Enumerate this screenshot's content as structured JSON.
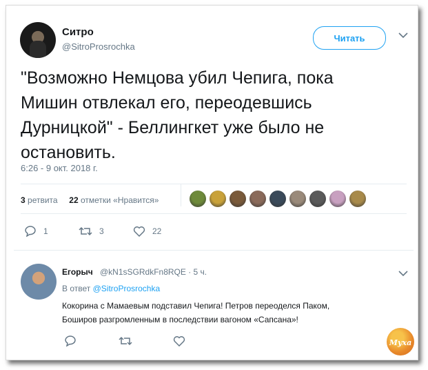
{
  "tweet": {
    "author_name": "Ситро",
    "author_handle": "@SitroProsrochka",
    "follow_label": "Читать",
    "text": "\"Возможно Немцова убил Чепига, пока Мишин отвлекал его, переодевшись Дурницкой\" - Беллингкет уже было не остановить.",
    "timestamp": "6:26 - 9 окт. 2018 г.",
    "retweets_count": "3",
    "retweets_label": "ретвита",
    "likes_count": "22",
    "likes_label": "отметки «Нравится»",
    "liker_avatar_colors": [
      "#6e8a3a",
      "#c9a23a",
      "#7a5a3a",
      "#8a6a5a",
      "#3a4a5a",
      "#9a8a7a",
      "#5a5a5a",
      "#c8a0c0",
      "#a88a4a"
    ]
  },
  "actions": {
    "reply_count": "1",
    "retweet_count": "3",
    "like_count": "22"
  },
  "reply": {
    "author_name": "Егорыч",
    "author_handle": "@kN1sSGRdkFn8RQE · 5 ч.",
    "in_reply_to_prefix": "В ответ",
    "in_reply_to_handle": "@SitroProsrochka",
    "text_line1": "Кокорина с Мамаевым подставил Чепига! Петров переоделся Паком,",
    "text_line2": "Боширов разгромленным в последствии вагоном «Сапсана»!"
  },
  "watermark_text": "Муха",
  "colors": {
    "accent": "#1da1f2",
    "muted": "#657786",
    "text": "#14171a",
    "divider": "#e6ecf0"
  }
}
